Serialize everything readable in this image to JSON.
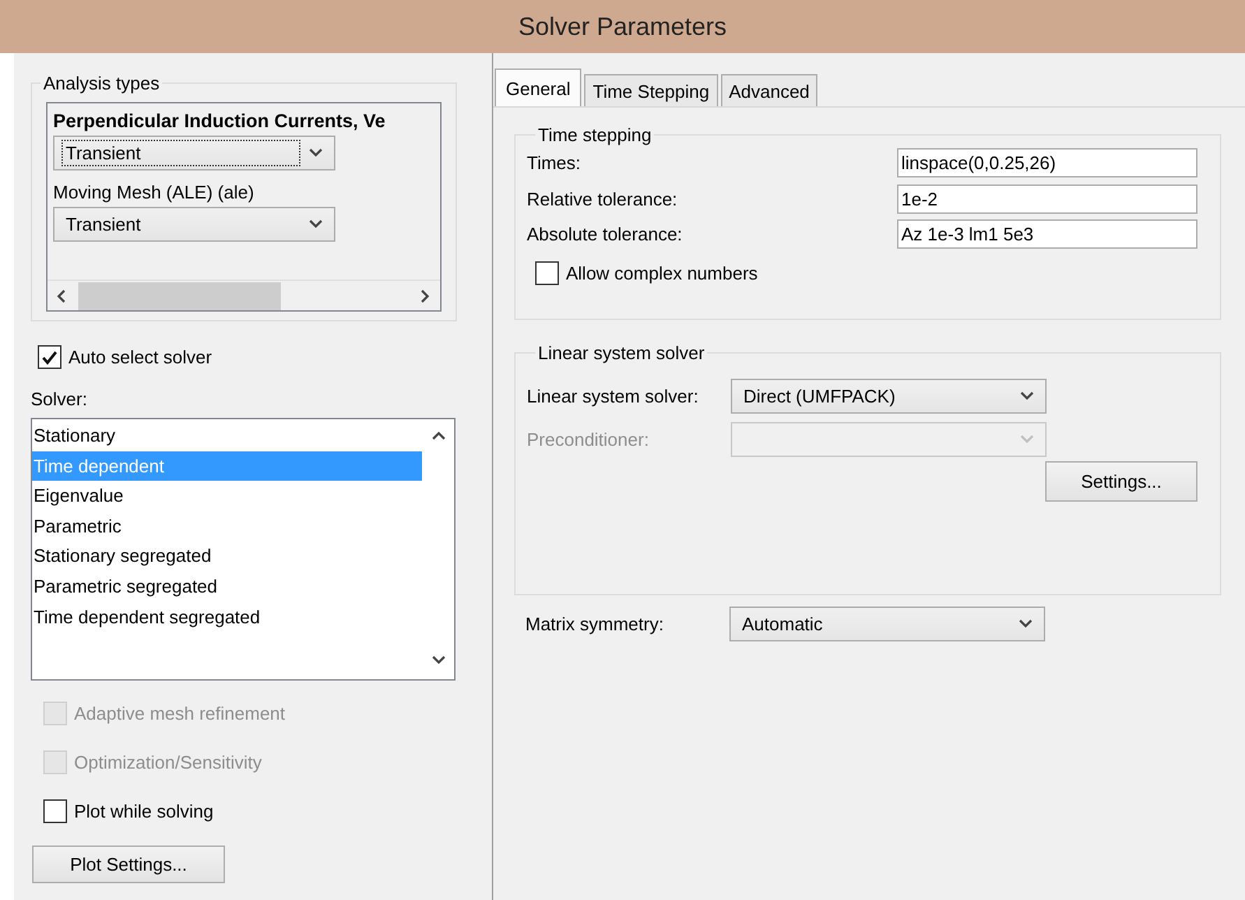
{
  "window": {
    "title": "Solver Parameters"
  },
  "analysis_types": {
    "label": "Analysis types",
    "physics": [
      {
        "name": "Perpendicular Induction Currents, Ve",
        "value": "Transient",
        "selected": true
      },
      {
        "name": "Moving Mesh (ALE) (ale)",
        "value": "Transient",
        "selected": false
      }
    ]
  },
  "auto_select_solver": {
    "label": "Auto select solver",
    "checked": true
  },
  "solver": {
    "label": "Solver:",
    "items": [
      {
        "label": "Stationary",
        "selected": false
      },
      {
        "label": "Time dependent",
        "selected": true
      },
      {
        "label": "Eigenvalue",
        "selected": false
      },
      {
        "label": "Parametric",
        "selected": false
      },
      {
        "label": "Stationary segregated",
        "selected": false
      },
      {
        "label": "Parametric segregated",
        "selected": false
      },
      {
        "label": "Time dependent segregated",
        "selected": false
      }
    ]
  },
  "options": [
    {
      "label": "Adaptive mesh refinement",
      "checked": false,
      "disabled": true
    },
    {
      "label": "Optimization/Sensitivity",
      "checked": false,
      "disabled": true
    },
    {
      "label": "Plot while solving",
      "checked": false,
      "disabled": false
    }
  ],
  "plot_settings_button": "Plot Settings...",
  "tabs": [
    {
      "label": "General",
      "selected": true
    },
    {
      "label": "Time Stepping",
      "selected": false
    },
    {
      "label": "Advanced",
      "selected": false
    }
  ],
  "time_stepping": {
    "title": "Time stepping",
    "fields": [
      {
        "label": "Times:",
        "value": "linspace(0,0.25,26)"
      },
      {
        "label": "Relative tolerance:",
        "value": "1e-2"
      },
      {
        "label": "Absolute tolerance:",
        "value": "Az 1e-3 lm1 5e3"
      }
    ],
    "allow_complex": {
      "label": "Allow complex numbers",
      "checked": false
    }
  },
  "linear_system_solver": {
    "title": "Linear system solver",
    "rows": [
      {
        "label": "Linear system solver:",
        "value": "Direct (UMFPACK)",
        "disabled": false
      },
      {
        "label": "Preconditioner:",
        "disabled": true
      }
    ],
    "settings_button": "Settings..."
  },
  "matrix_symmetry": {
    "label": "Matrix symmetry:",
    "value": "Automatic"
  }
}
